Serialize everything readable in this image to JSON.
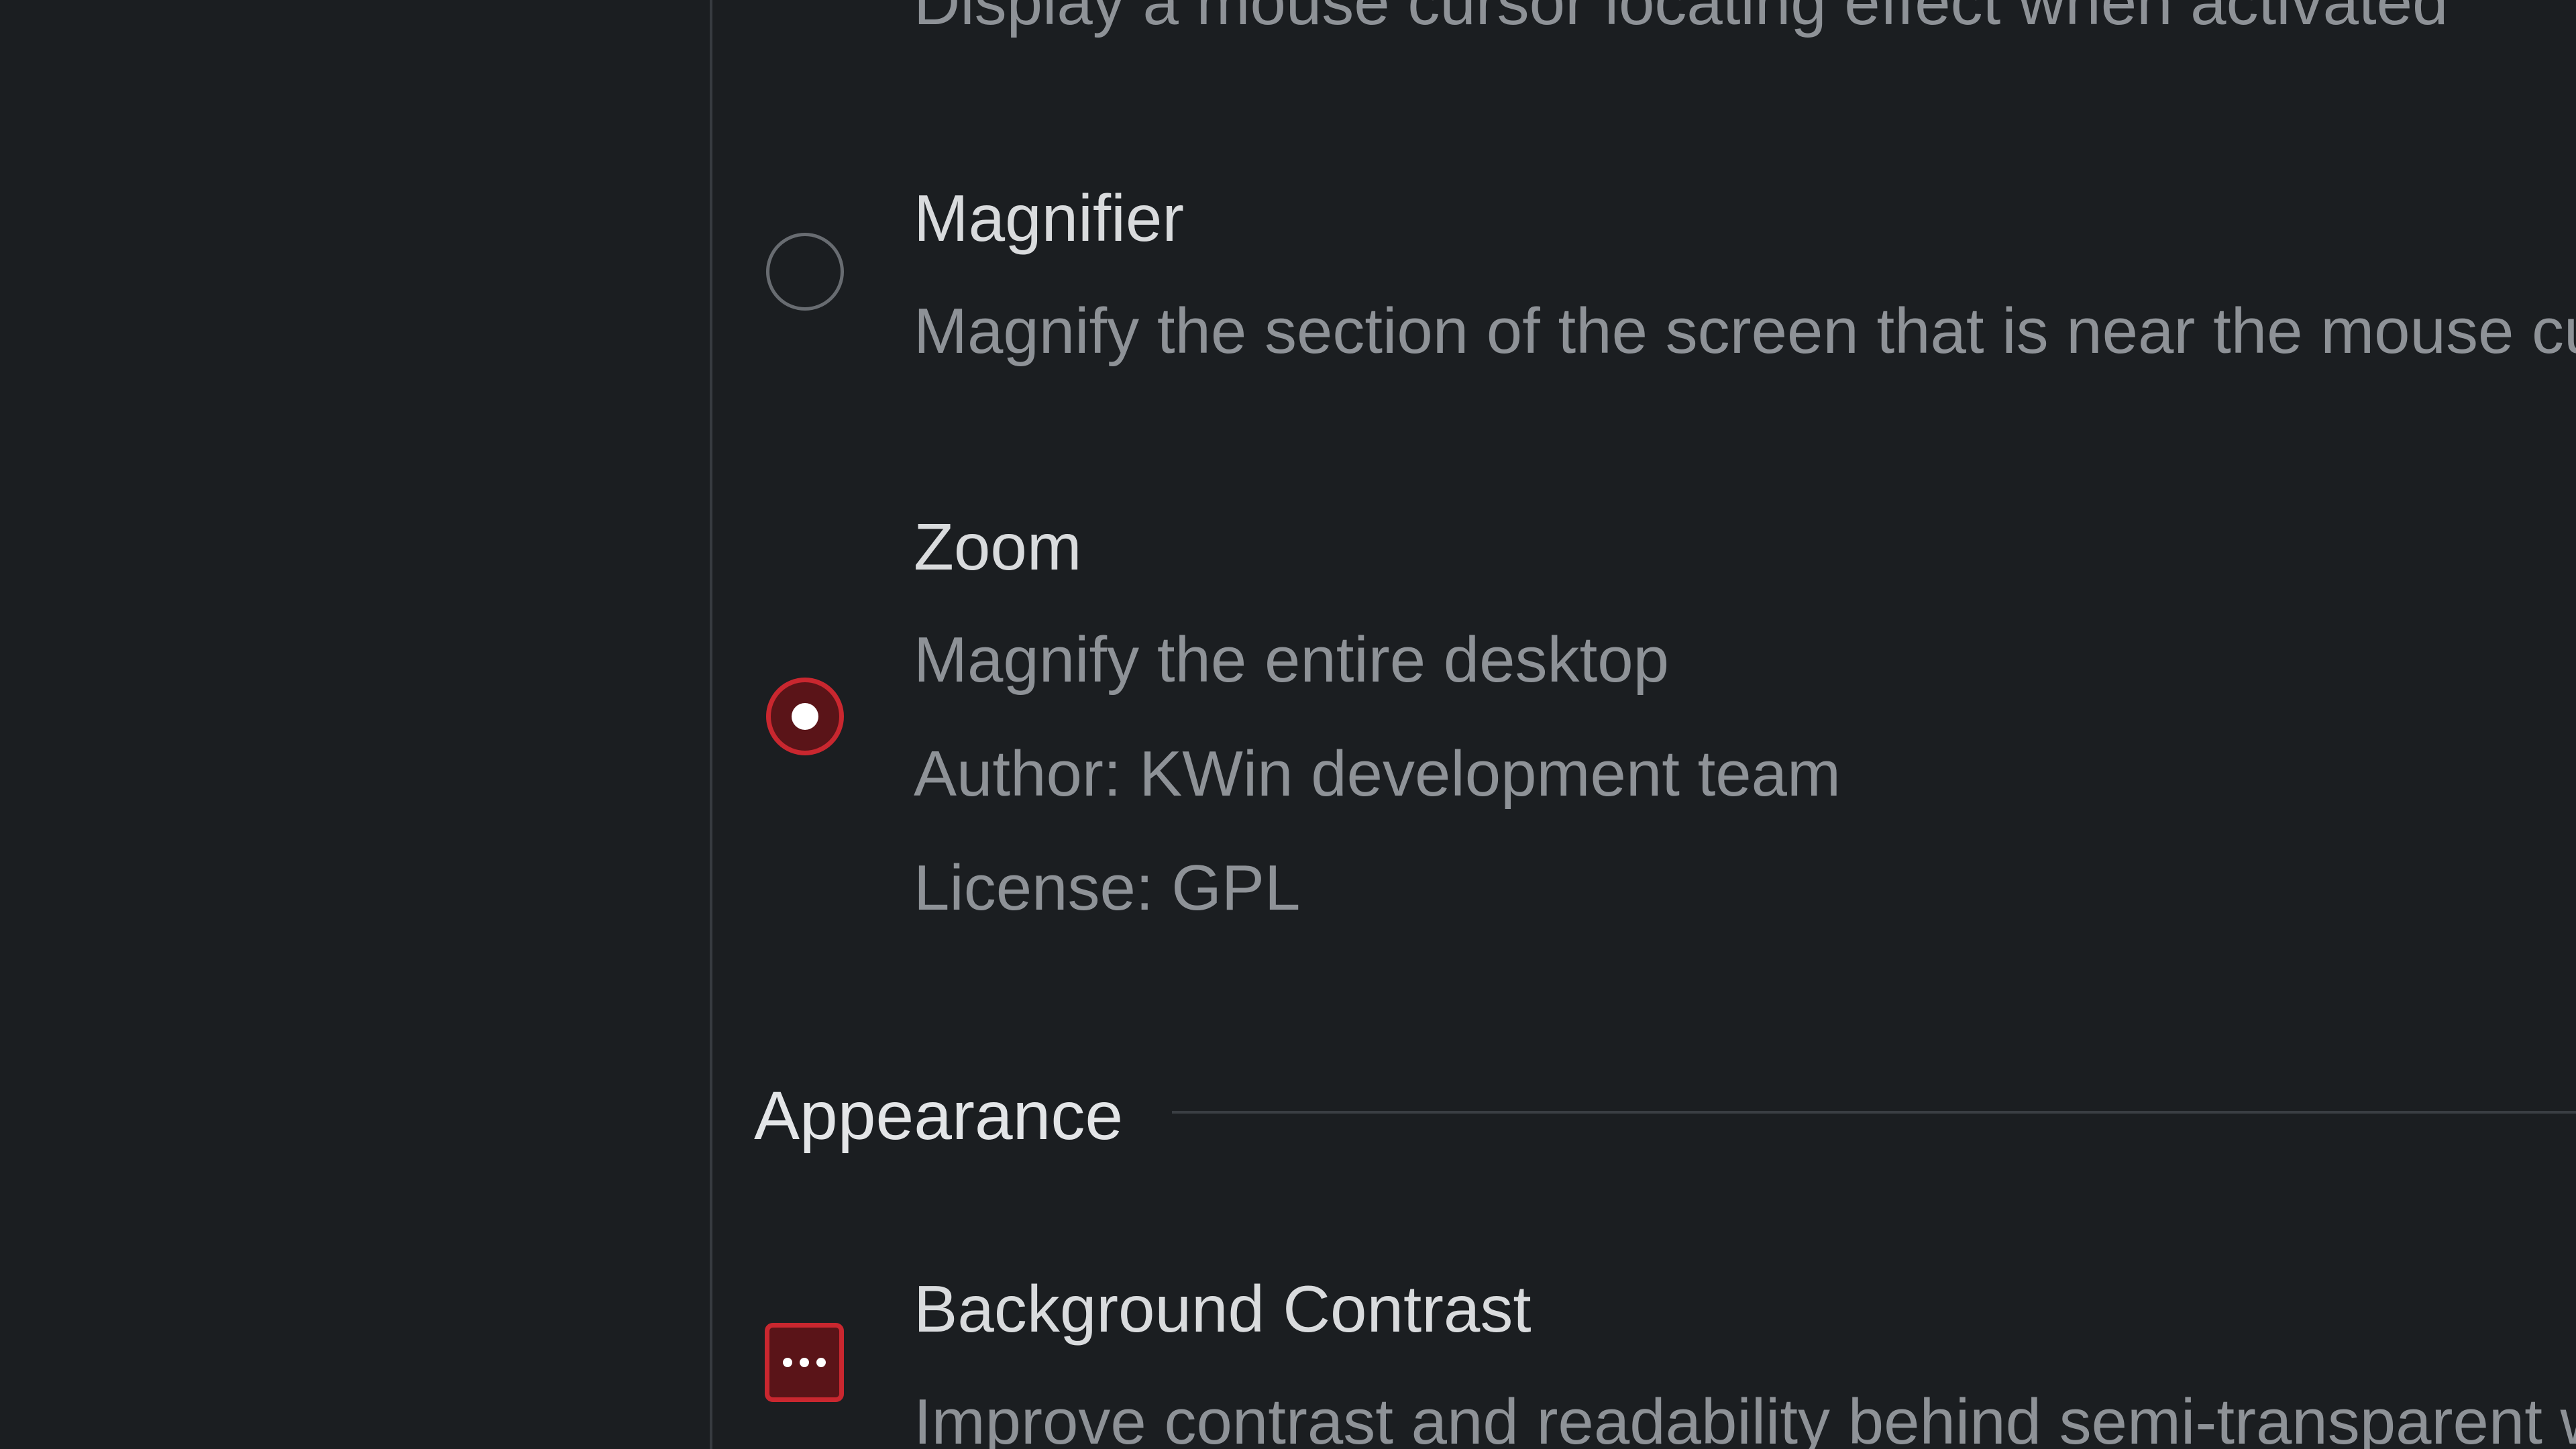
{
  "effects": {
    "mouse_locator_desc_partial": "Display a mouse cursor locating effect when activated",
    "magnifier": {
      "title": "Magnifier",
      "description": "Magnify the section of the screen that is near the mouse cursor",
      "selected": false
    },
    "zoom": {
      "title": "Zoom",
      "description": "Magnify the entire desktop",
      "author": "Author: KWin development team",
      "license": "License: GPL",
      "selected": true
    }
  },
  "appearance": {
    "section_title": "Appearance",
    "background_contrast": {
      "title": "Background Contrast",
      "description": "Improve contrast and readability behind semi-transparent windows"
    }
  },
  "colors": {
    "background": "#1b1e21",
    "accent": "#c9272f",
    "text_primary": "#d9dbdd",
    "text_secondary": "#8e9297"
  },
  "icons": {
    "configure": "more-dots-icon"
  }
}
